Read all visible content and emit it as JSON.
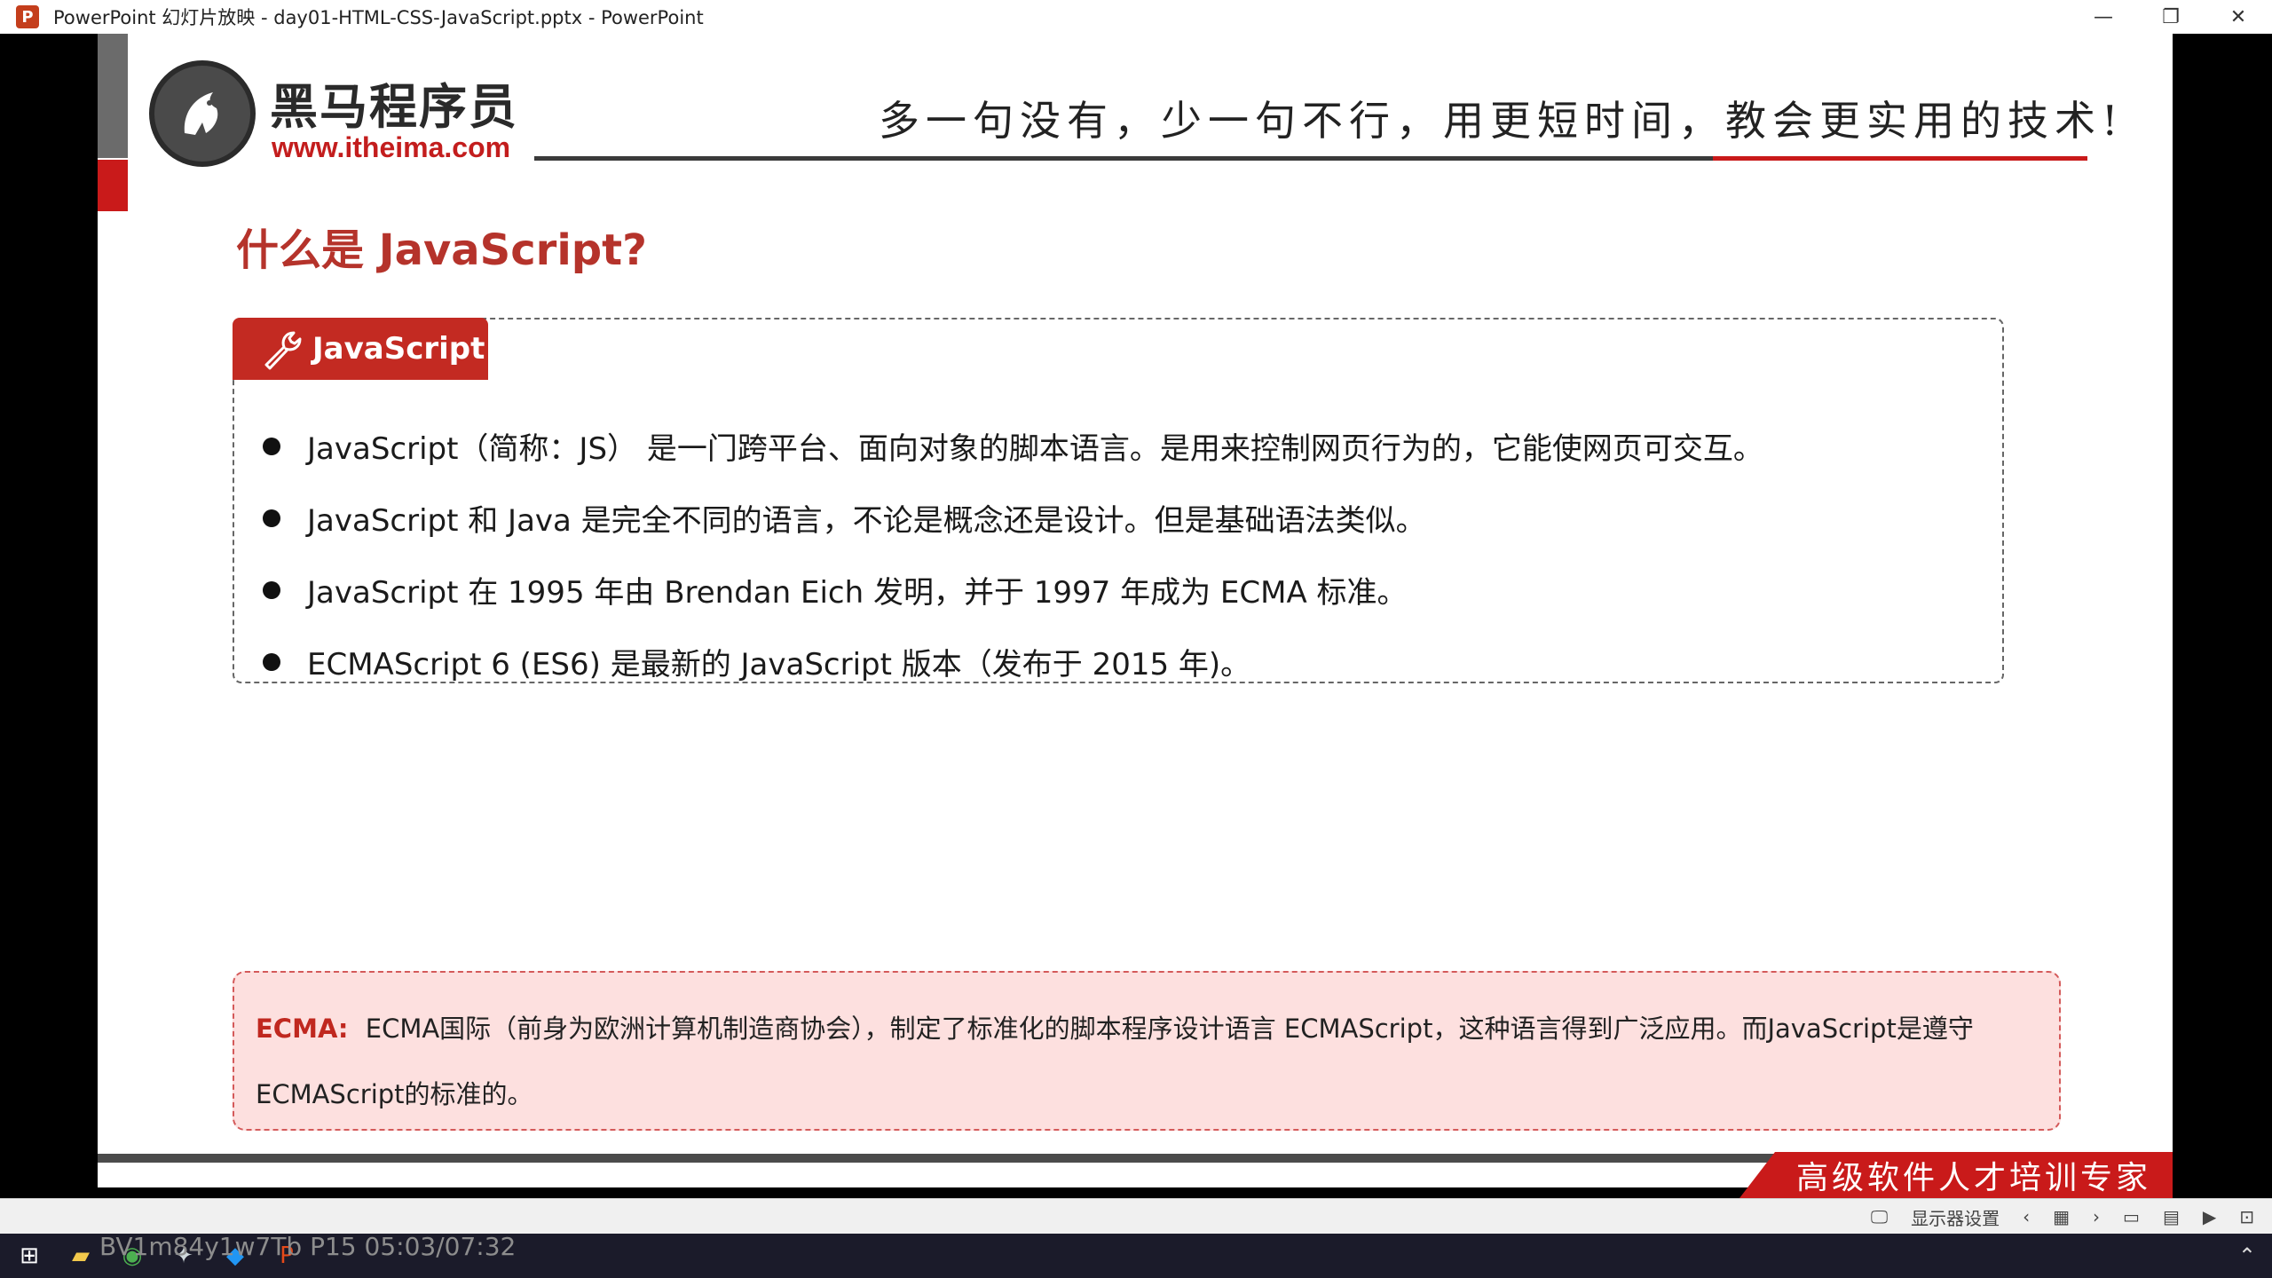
{
  "window": {
    "title": "PowerPoint 幻灯片放映  -  day01-HTML-CSS-JavaScript.pptx - PowerPoint",
    "icon_letter": "P",
    "controls": [
      "—",
      "❐",
      "✕"
    ]
  },
  "header": {
    "logo_name": "黑马程序员",
    "logo_url": "www.itheima.com",
    "slogan": "多一句没有，少一句不行，用更短时间，教会更实用的技术!"
  },
  "slide": {
    "heading": "什么是 JavaScript?",
    "box_tab_label": "JavaScript",
    "bullets": [
      "JavaScript（简称：JS） 是一门跨平台、面向对象的脚本语言。是用来控制网页行为的，它能使网页可交互。",
      "JavaScript 和 Java 是完全不同的语言，不论是概念还是设计。但是基础语法类似。",
      "JavaScript 在 1995 年由 Brendan Eich 发明，并于 1997 年成为 ECMA 标准。",
      "ECMAScript 6 (ES6) 是最新的 JavaScript 版本（发布于 2015 年)。"
    ],
    "ecma_label": "ECMA:",
    "ecma_text": "ECMA国际（前身为欧洲计算机制造商协会），制定了标准化的脚本程序设计语言 ECMAScript，这种语言得到广泛应用。而JavaScript是遵守ECMAScript的标准的。",
    "promo": "高级软件人才培训专家"
  },
  "control_bar": {
    "display_settings": "显示器设置",
    "prev": "‹",
    "next": "›"
  },
  "taskbar": {
    "overlay_text": "BV1m84y1w7Tb P15 05:03/07:32"
  },
  "colors": {
    "accent_red": "#c91a1a",
    "heading_red": "#b5332b",
    "ecma_bg": "#fde0df"
  }
}
